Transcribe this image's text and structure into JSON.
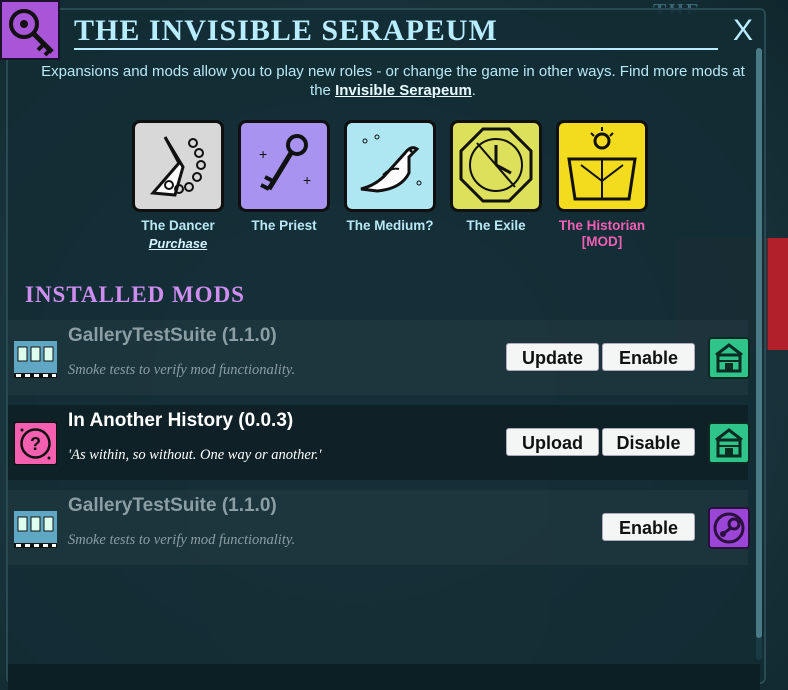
{
  "header": {
    "title": "THE INVISIBLE SERAPEUM",
    "close_label": "X",
    "description_before": "Expansions and mods allow you to play new roles - or change the game in other ways. Find more mods at the ",
    "description_link": "Invisible Serapeum",
    "description_after": "."
  },
  "background": {
    "top_right_text": "THE INVISIBLE"
  },
  "roles": [
    {
      "name": "The Dancer",
      "action": "Purchase",
      "icon": "dancer-icon",
      "bg": "#d8d8d8"
    },
    {
      "name": "The Priest",
      "icon": "key-icon",
      "bg": "#a893f0"
    },
    {
      "name": "The Medium?",
      "icon": "dove-icon",
      "bg": "#aee7f2"
    },
    {
      "name": "The Exile",
      "icon": "clock-icon",
      "bg": "#dce05a"
    },
    {
      "name": "The Historian",
      "tag": "[MOD]",
      "icon": "sundial-icon",
      "bg": "#f2dc1d"
    }
  ],
  "installed": {
    "heading": "INSTALLED MODS",
    "mods": [
      {
        "name": "GalleryTestSuite (1.1.0)",
        "description": "Smoke tests to verify mod functionality.",
        "buttons": [
          "Update",
          "Enable"
        ],
        "source": "store-icon"
      },
      {
        "name": "In Another History (0.0.3)",
        "description": "'As within, so without. One way or another.'",
        "buttons": [
          "Upload",
          "Disable"
        ],
        "source": "store-icon"
      },
      {
        "name": "GalleryTestSuite (1.1.0)",
        "description": "Smoke tests to verify mod functionality.",
        "buttons": [
          "Enable"
        ],
        "source": "steam-icon"
      }
    ]
  },
  "colors": {
    "title": "#b8ecff",
    "heading": "#cf8df0",
    "mod_tag": "#f25fb5",
    "store": "#2fc58a",
    "steam": "#9b46d6"
  }
}
